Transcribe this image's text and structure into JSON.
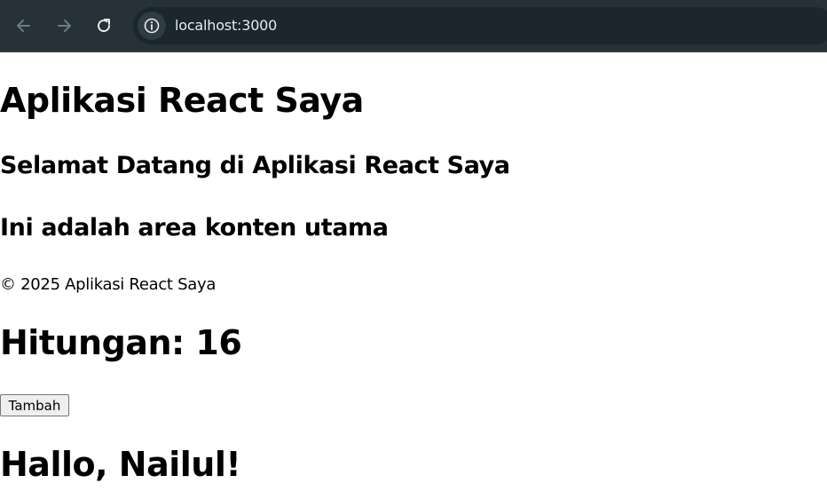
{
  "browser": {
    "url": "localhost:3000",
    "icons": {
      "back": "arrow-left-icon",
      "forward": "arrow-right-icon",
      "reload": "reload-icon",
      "site_info": "info-icon"
    },
    "colors": {
      "toolbar_bg": "#263238",
      "omnibox_bg": "#1b262d",
      "url_text": "#e8eaed"
    }
  },
  "header": {
    "title": "Aplikasi React Saya",
    "welcome": "Selamat Datang di Aplikasi React Saya"
  },
  "main": {
    "content": "Ini adalah area konten utama"
  },
  "footer": {
    "text": "© 2025 Aplikasi React Saya"
  },
  "counter": {
    "text": "Hitungan: 16",
    "button_label": "Tambah"
  },
  "greeting": {
    "text": "Hallo, Nailul!"
  }
}
